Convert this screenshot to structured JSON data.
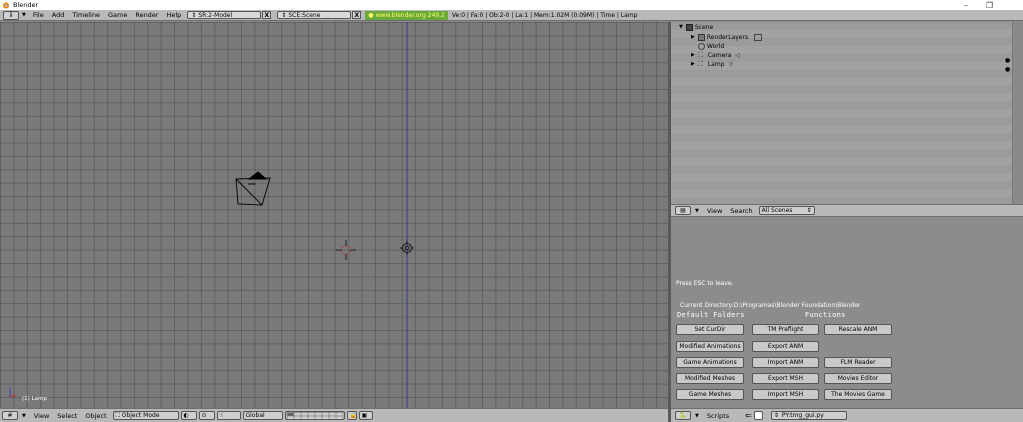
{
  "window": {
    "title": "Blender",
    "minimize": "–",
    "maximize": "❐"
  },
  "topbar": {
    "menus": [
      "File",
      "Add",
      "Timeline",
      "Game",
      "Render",
      "Help"
    ],
    "screen_field": "SR:2-Model",
    "scene_field": "SCE:Scene",
    "url": "www.blender.org 249.2",
    "stats": "Ve:0 | Fa:0 | Ob:2-0 | La:1  | Mem:1.02M (0.09M)  | Time  | Lamp"
  },
  "viewport": {
    "info": "(1) Lamp",
    "header": {
      "menus": [
        "View",
        "Select",
        "Object"
      ],
      "mode": "Object Mode",
      "orientation": "Global"
    }
  },
  "outliner": {
    "items": [
      {
        "label": "Scene"
      },
      {
        "label": "RenderLayers"
      },
      {
        "label": "World"
      },
      {
        "label": "Camera"
      },
      {
        "label": "Lamp"
      }
    ],
    "header": {
      "view": "View",
      "search": "Search",
      "filter": "All Scenes"
    }
  },
  "scripts": {
    "esc_text": "Press ESC to leave.",
    "current_dir": "Current Directory:D:\\Programas\\Blender Foundation\\Blender",
    "default_folders": "Default Folders",
    "functions": "Functions",
    "buttons": {
      "set_curdir": "Set CurDir",
      "tm_preflight": "TM Preflight",
      "rescale_anm": "Rescale ANM",
      "modified_animations": "Modified Animations",
      "export_anm": "Export ANM",
      "game_animations": "Game Animations",
      "import_anm": "Import ANM",
      "flm_reader": "FLM Reader",
      "modified_meshes": "Modified Meshes",
      "export_msh": "Export MSH",
      "movies_editor": "Movies Editor",
      "game_meshes": "Game Meshes",
      "import_msh": "Import MSH",
      "movies_game": "The Movies Game"
    },
    "header": {
      "menu": "Scripts",
      "script_field": "PY:tmg_gui.py"
    }
  }
}
